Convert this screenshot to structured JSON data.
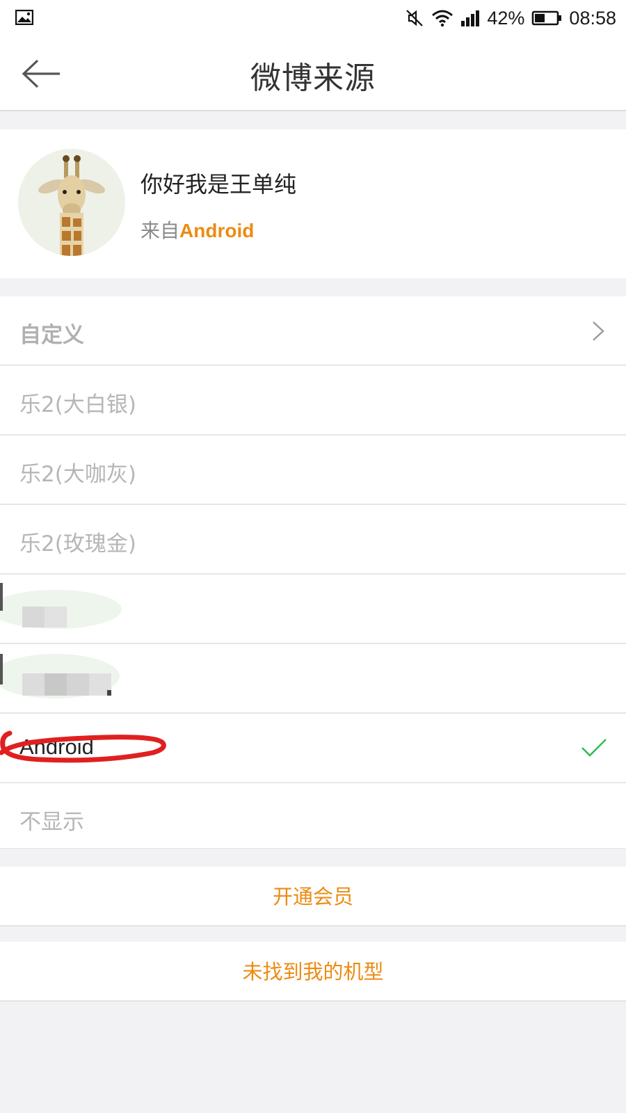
{
  "status_bar": {
    "battery_percent": "42%",
    "time": "08:58",
    "icons": [
      "gallery-icon",
      "mute-icon",
      "wifi-icon",
      "signal-icon",
      "battery-icon"
    ]
  },
  "header": {
    "title": "微博来源",
    "back_icon": "arrow-left-icon"
  },
  "profile": {
    "name": "你好我是王单纯",
    "source_prefix": "来自",
    "source_device": "Android",
    "avatar_icon": "giraffe-avatar"
  },
  "options": [
    {
      "label": "自定义",
      "style": "custom",
      "trailing": "chevron-right-icon"
    },
    {
      "label": "乐2(大白银)",
      "style": "normal"
    },
    {
      "label": "乐2(大咖灰)",
      "style": "normal"
    },
    {
      "label": "乐2(玫瑰金)",
      "style": "normal"
    },
    {
      "label": "",
      "style": "redacted"
    },
    {
      "label": "",
      "style": "redacted"
    },
    {
      "label": "Android",
      "style": "selected",
      "trailing": "check-icon"
    },
    {
      "label": "不显示",
      "style": "normal"
    }
  ],
  "actions": {
    "open_membership": "开通会员",
    "model_not_found": "未找到我的机型"
  },
  "colors": {
    "accent": "#ec8b12",
    "check": "#2bbd4c",
    "annotation": "#e02020",
    "background": "#f2f1f4"
  }
}
